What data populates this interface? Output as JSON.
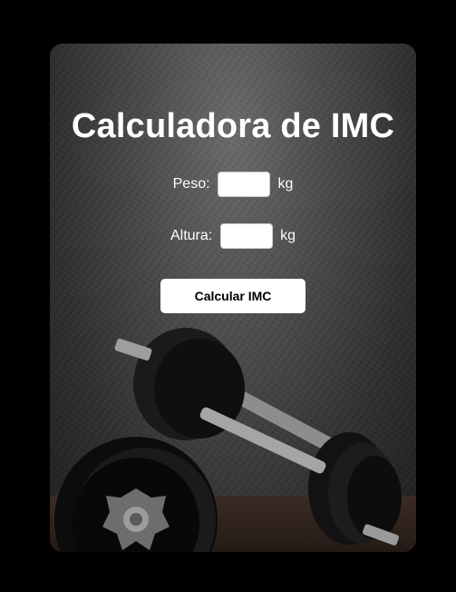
{
  "title": "Calculadora de IMC",
  "peso": {
    "label": "Peso:",
    "value": "",
    "unit": "kg"
  },
  "altura": {
    "label": "Altura:",
    "value": "",
    "unit": "kg"
  },
  "button": {
    "label": "Calcular IMC"
  },
  "colors": {
    "page_background": "#000000",
    "text": "#ffffff",
    "button_background": "#ffffff",
    "button_text": "#000000"
  },
  "background_image": "dumbbells-on-concrete-wall"
}
